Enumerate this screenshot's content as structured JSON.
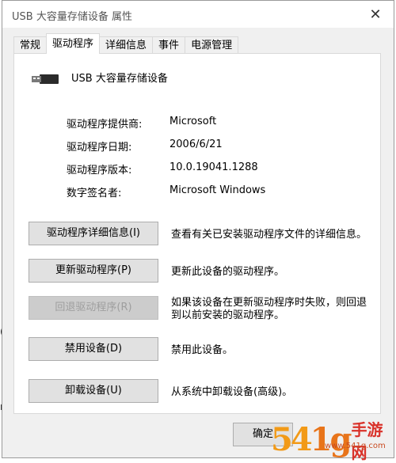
{
  "window": {
    "title": "USB 大容量存储设备 属性",
    "close_glyph": "✕"
  },
  "tabs": [
    {
      "label": "常规"
    },
    {
      "label": "驱动程序"
    },
    {
      "label": "详细信息"
    },
    {
      "label": "事件"
    },
    {
      "label": "电源管理"
    }
  ],
  "device": {
    "name": "USB 大容量存储设备",
    "icon": "usb-connector-icon"
  },
  "driver_info": [
    {
      "label": "驱动程序提供商:",
      "value": "Microsoft"
    },
    {
      "label": "驱动程序日期:",
      "value": "2006/6/21"
    },
    {
      "label": "驱动程序版本:",
      "value": "10.0.19041.1288"
    },
    {
      "label": "数字签名者:",
      "value": "Microsoft Windows"
    }
  ],
  "actions": [
    {
      "button": "驱动程序详细信息(I)",
      "desc": "查看有关已安装驱动程序文件的详细信息。",
      "enabled": true
    },
    {
      "button": "更新驱动程序(P)",
      "desc": "更新此设备的驱动程序。",
      "enabled": true
    },
    {
      "button": "回退驱动程序(R)",
      "desc": "如果该设备在更新驱动程序时失败，则回退到以前安装的驱动程序。",
      "enabled": false
    },
    {
      "button": "禁用设备(D)",
      "desc": "禁用此设备。",
      "enabled": true
    },
    {
      "button": "卸载设备(U)",
      "desc": "从系统中卸载设备(高级)。",
      "enabled": true
    }
  ],
  "footer": {
    "ok_label": "确定"
  },
  "background_fragments": {
    "a": "(N",
    "b": "rk"
  },
  "watermark": {
    "main": "54",
    "mid": "1g",
    "side": "手游网",
    "url": "www.541g.com"
  }
}
